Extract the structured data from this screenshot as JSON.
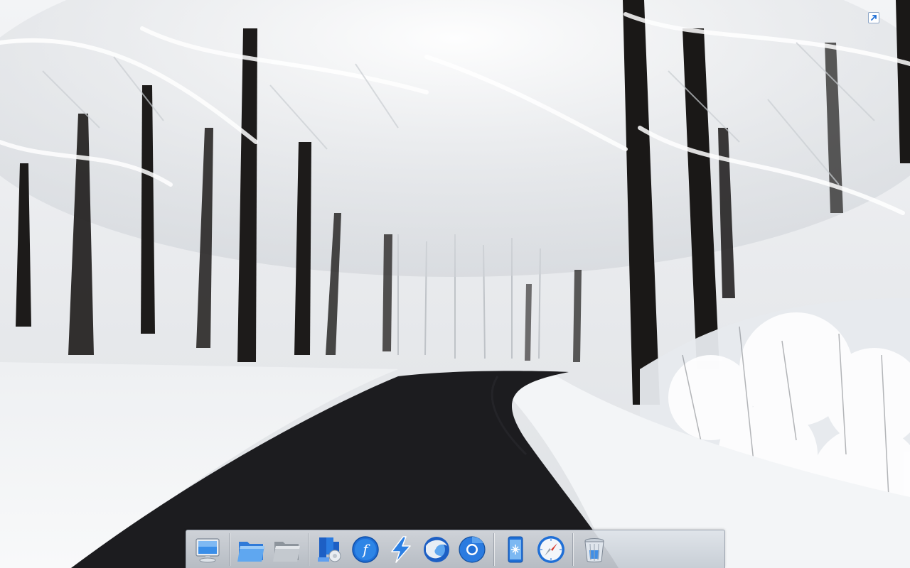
{
  "desktop": {
    "wallpaper": "snowy-forest-road",
    "corner_icon": "shortcut-arrow-icon"
  },
  "dock": {
    "groups": [
      {
        "items": [
          {
            "icon": "computer-monitor-icon"
          }
        ]
      },
      {
        "items": [
          {
            "icon": "blue-folder-icon"
          },
          {
            "icon": "gray-folder-icon"
          }
        ]
      },
      {
        "items": [
          {
            "icon": "office-suite-icon"
          },
          {
            "icon": "flash-player-icon"
          },
          {
            "icon": "lightning-launcher-icon"
          },
          {
            "icon": "firefox-icon"
          },
          {
            "icon": "chrome-icon"
          }
        ]
      },
      {
        "items": [
          {
            "icon": "phone-snowflake-icon"
          },
          {
            "icon": "safari-compass-icon"
          }
        ]
      },
      {
        "items": [
          {
            "icon": "trash-bin-icon"
          }
        ]
      }
    ],
    "colors": {
      "accent_blue": "#1f6fd6",
      "folder_blue": "#3f8ee6",
      "road": "#1c1c1f",
      "snow": "#f4f6f8"
    }
  }
}
